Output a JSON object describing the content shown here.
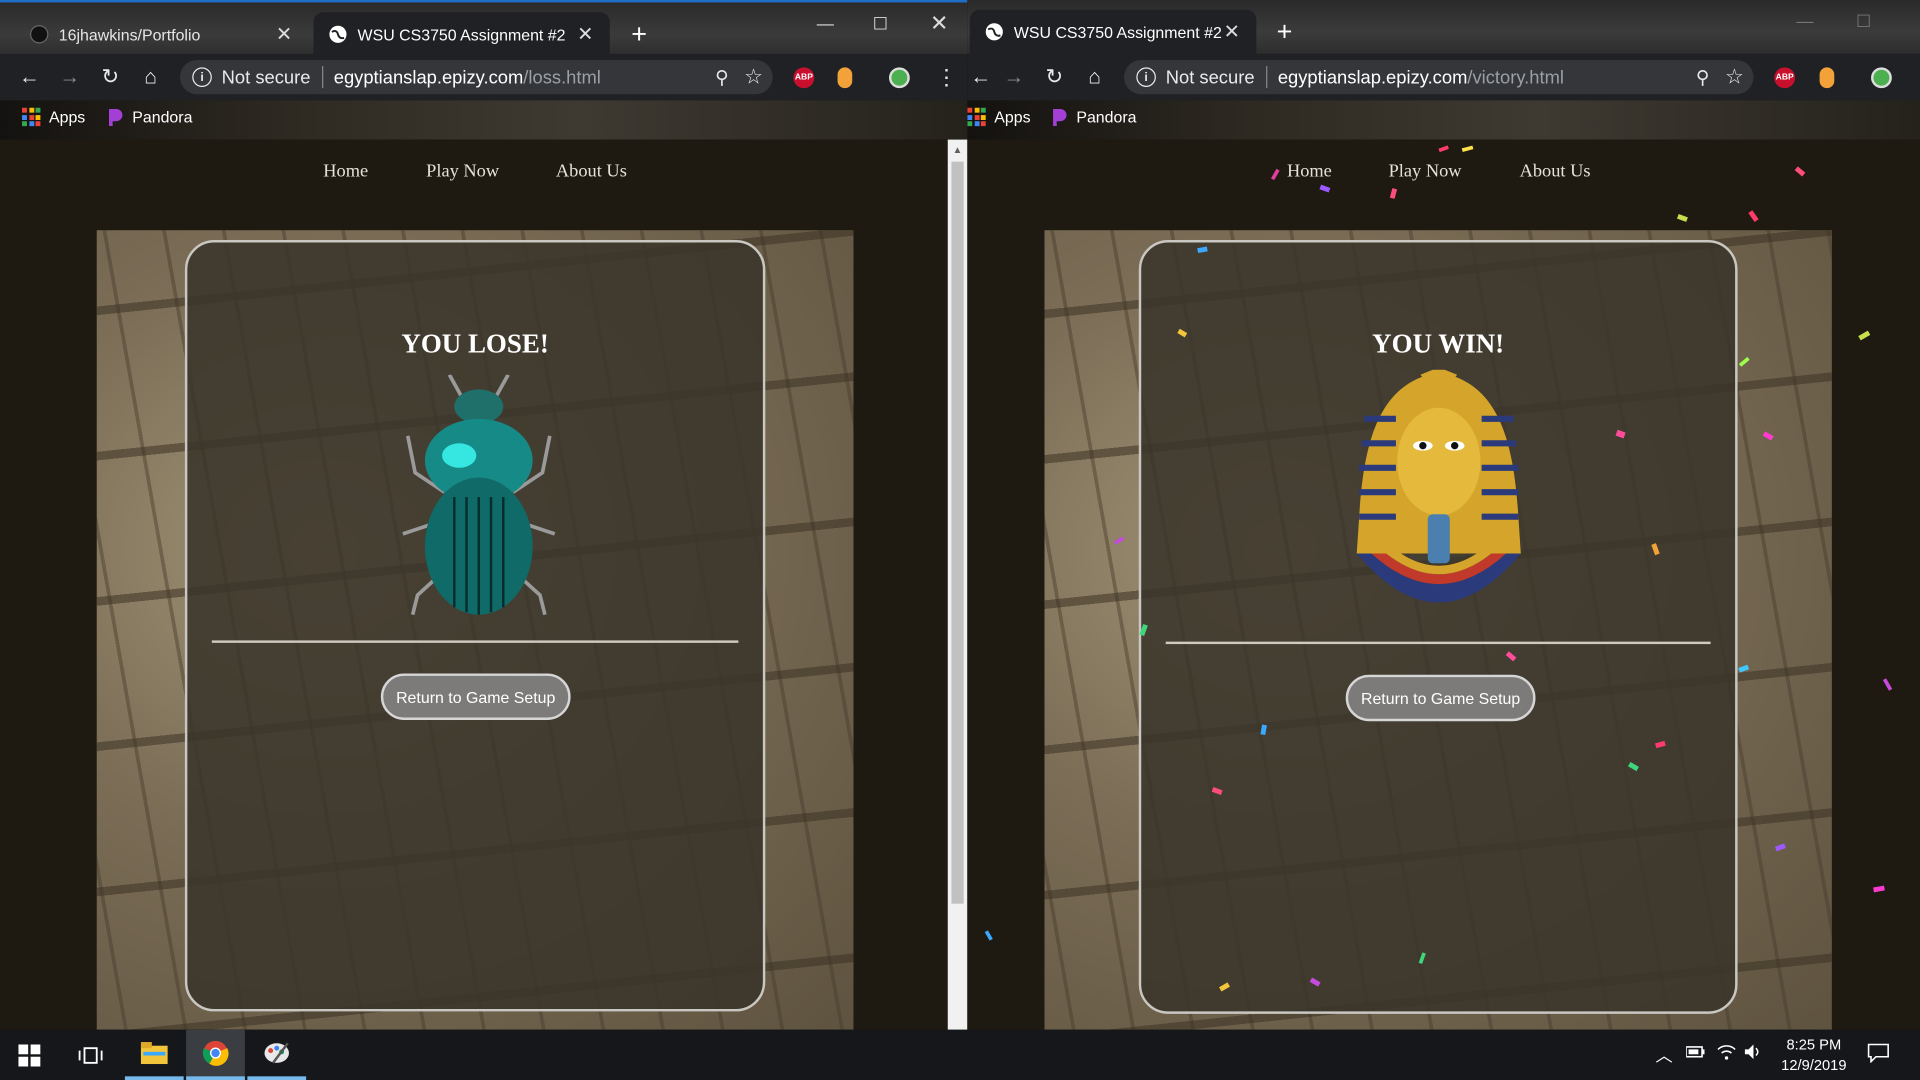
{
  "left_window": {
    "tabs": [
      {
        "label": "16jhawkins/Portfolio",
        "active": false
      },
      {
        "label": "WSU CS3750 Assignment #2",
        "active": true
      }
    ],
    "security_label": "Not secure",
    "url_host": "egyptianslap.epizy.com",
    "url_path": "/loss.html",
    "bookmarks": [
      {
        "label": "Apps"
      },
      {
        "label": "Pandora"
      }
    ],
    "nav": [
      "Home",
      "Play Now",
      "About Us"
    ],
    "card": {
      "title": "YOU LOSE!",
      "image": "scarab-beetle",
      "button_label": "Return to Game Setup"
    }
  },
  "right_window": {
    "tabs": [
      {
        "label": "WSU CS3750 Assignment #2",
        "active": true
      }
    ],
    "security_label": "Not secure",
    "url_host": "egyptianslap.epizy.com",
    "url_path": "/victory.html",
    "bookmarks": [
      {
        "label": "Apps"
      },
      {
        "label": "Pandora"
      }
    ],
    "nav": [
      "Home",
      "Play Now",
      "About Us"
    ],
    "card": {
      "title": "YOU WIN!",
      "image": "pharaoh-mask",
      "button_label": "Return to Game Setup"
    }
  },
  "taskbar": {
    "apps": [
      "windows-start",
      "task-view",
      "file-explorer",
      "chrome",
      "paint"
    ],
    "time": "8:25 PM",
    "date": "12/9/2019"
  },
  "colors": {
    "page_bg": "#1e1a12",
    "card_border": "#c9c7c2",
    "button_bg": "#7c7b79",
    "taskbar_accent": "#76b9ed"
  }
}
